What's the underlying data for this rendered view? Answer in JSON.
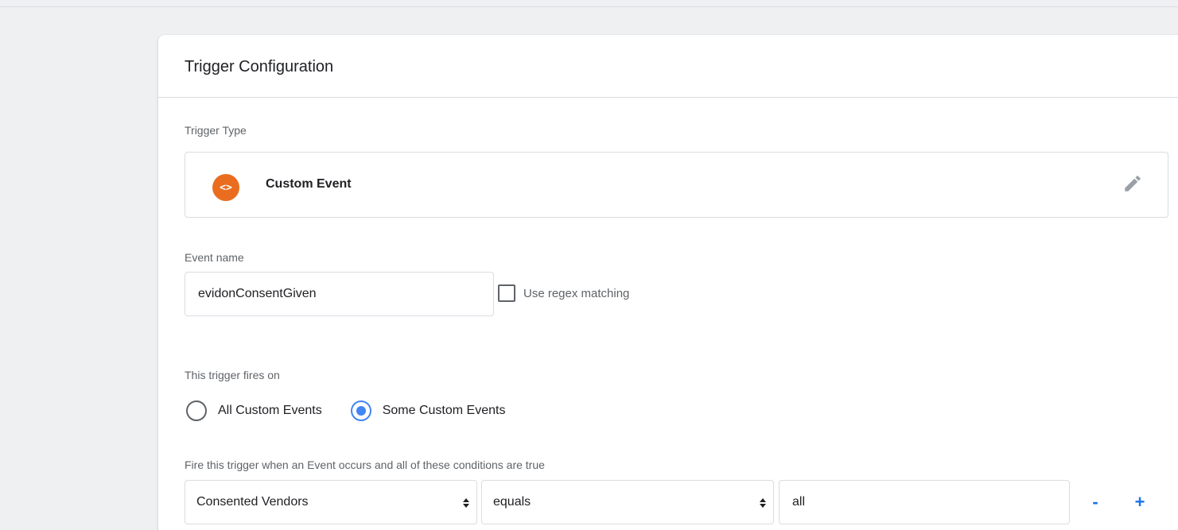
{
  "header": {
    "title": "Trigger Configuration"
  },
  "trigger_type": {
    "label": "Trigger Type",
    "name": "Custom Event",
    "icon": "code-brackets-icon",
    "icon_glyph": "<>",
    "accent": "#ea6d1f"
  },
  "event_name": {
    "label": "Event name",
    "value": "evidonConsentGiven",
    "regex_label": "Use regex matching",
    "regex_checked": false
  },
  "fires_on": {
    "label": "This trigger fires on",
    "options": [
      {
        "label": "All Custom Events",
        "selected": false
      },
      {
        "label": "Some Custom Events",
        "selected": true
      }
    ]
  },
  "conditions": {
    "label": "Fire this trigger when an Event occurs and all of these conditions are true",
    "row": {
      "variable": "Consented Vendors",
      "operator": "equals",
      "value": "all"
    },
    "remove_glyph": "-",
    "add_glyph": "+"
  },
  "colors": {
    "primary_blue": "#1a73e8",
    "radio_blue": "#4285f4",
    "border": "#dadce0"
  }
}
